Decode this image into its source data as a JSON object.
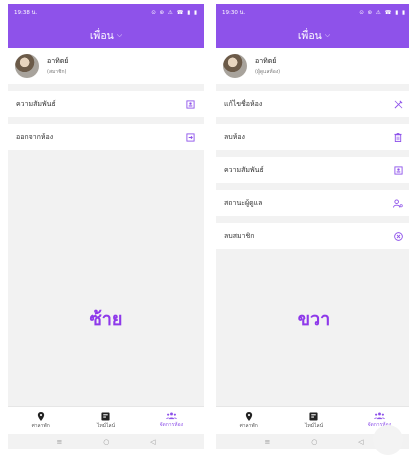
{
  "left": {
    "status_time": "19:38 น.",
    "status_icons": "⊙ ⊛ ⚠ ☎ ▮ ▮",
    "appbar_title": "เพื่อน",
    "user_name": "อาทิตย์",
    "user_sub": "(สมาชิก)",
    "menu": [
      {
        "label": "ความสัมพันธ์",
        "icon": "contact-card-icon"
      },
      {
        "label": "ออกจากห้อง",
        "icon": "exit-door-icon"
      }
    ],
    "big_label": "ซ้าย",
    "nav": [
      {
        "label": "ศาลาพัก",
        "icon": "location-pin-icon"
      },
      {
        "label": "ไทม์ไลน์",
        "icon": "timeline-icon"
      },
      {
        "label": "จัดการห้อง",
        "icon": "manage-room-icon"
      }
    ]
  },
  "right": {
    "status_time": "19:30 น.",
    "status_icons": "⊙ ⊛ ⚠ ☎ ▮ ▮",
    "appbar_title": "เพื่อน",
    "user_name": "อาทิตย์",
    "user_sub": "(ผู้ดูแลห้อง)",
    "menu": [
      {
        "label": "แก้ไขชื่อห้อง",
        "icon": "edit-name-icon"
      },
      {
        "label": "ลบห้อง",
        "icon": "trash-icon"
      },
      {
        "label": "ความสัมพันธ์",
        "icon": "contact-card-icon"
      },
      {
        "label": "สถานะผู้ดูแล",
        "icon": "admin-status-icon"
      },
      {
        "label": "ลบสมาชิก",
        "icon": "remove-member-icon"
      }
    ],
    "big_label": "ขวา",
    "nav": [
      {
        "label": "ศาลาพัก",
        "icon": "location-pin-icon"
      },
      {
        "label": "ไทม์ไลน์",
        "icon": "timeline-icon"
      },
      {
        "label": "จัดการห้อง",
        "icon": "manage-room-icon"
      }
    ]
  },
  "system_nav": {
    "menu": "≡",
    "home": "○",
    "back": "◁"
  },
  "colors": {
    "accent": "#8e52ea",
    "label": "#8e39ea"
  }
}
